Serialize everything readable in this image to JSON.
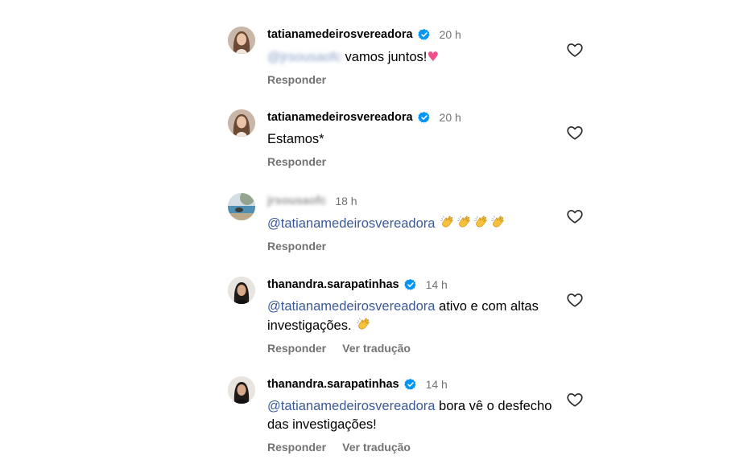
{
  "comments": [
    {
      "username": "tatianamedeirosvereadora",
      "verified": true,
      "time": "20 h",
      "mention": "@jrsousaofc",
      "mention_blurred": true,
      "text": " vamos juntos!",
      "emoji": "heart",
      "reply_label": "Responder",
      "avatar": "woman-brown-hair"
    },
    {
      "username": "tatianamedeirosvereadora",
      "verified": true,
      "time": "20 h",
      "text": "Estamos*",
      "reply_label": "Responder",
      "avatar": "woman-brown-hair"
    },
    {
      "username": "jrsousaofc",
      "username_blurred": true,
      "verified": false,
      "time": "18 h",
      "mention": "@tatianamedeirosvereadora",
      "emoji": "clapping-hands x4",
      "reply_label": "Responder",
      "avatar": "beach-scene"
    },
    {
      "username": "thanandra.sarapatinhas",
      "verified": true,
      "time": "14 h",
      "mention": "@tatianamedeirosvereadora",
      "text": " ativo e com altas investigações.",
      "emoji": "clapping-hands",
      "reply_label": "Responder",
      "translate_label": "Ver tradução",
      "avatar": "woman-dark-hair"
    },
    {
      "username": "thanandra.sarapatinhas",
      "verified": true,
      "time": "14 h",
      "mention": "@tatianamedeirosvereadora",
      "text": " bora vê o desfecho das investigações!",
      "reply_label": "Responder",
      "translate_label": "Ver tradução",
      "avatar": "woman-dark-hair"
    }
  ],
  "colors": {
    "mention": "#3b5998",
    "meta": "#737373",
    "verified": "#0095f6",
    "heart_emoji": "#f0508c"
  }
}
